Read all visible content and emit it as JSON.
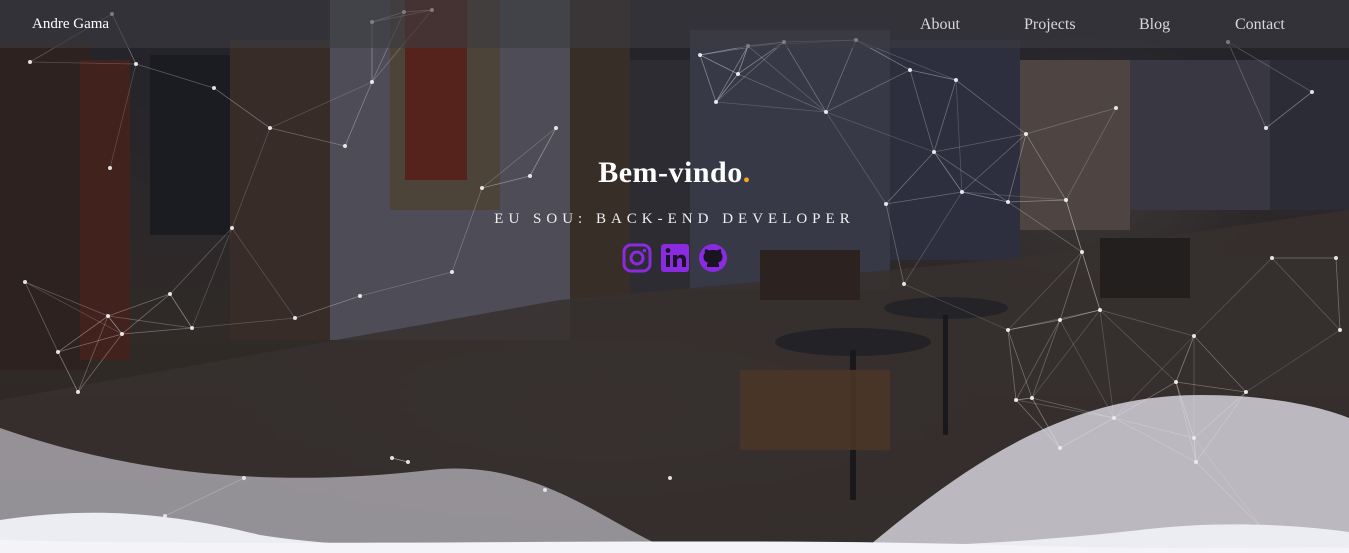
{
  "navbar": {
    "brand": "Andre Gama",
    "links": [
      {
        "label": "About"
      },
      {
        "label": "Projects"
      },
      {
        "label": "Blog"
      },
      {
        "label": "Contact"
      }
    ]
  },
  "hero": {
    "title": "Bem-vindo",
    "title_dot": ".",
    "subtitle_prefix": "EU SOU:",
    "subtitle_role": "BACK-END DEVELOPER"
  },
  "socials": [
    {
      "name": "instagram",
      "icon": "instagram-icon"
    },
    {
      "name": "linkedin",
      "icon": "linkedin-icon"
    },
    {
      "name": "github",
      "icon": "github-icon"
    }
  ],
  "colors": {
    "accent_dot": "#f5a623",
    "social_icons": "#8a2be2",
    "nav_text": "#d8d8dc"
  }
}
